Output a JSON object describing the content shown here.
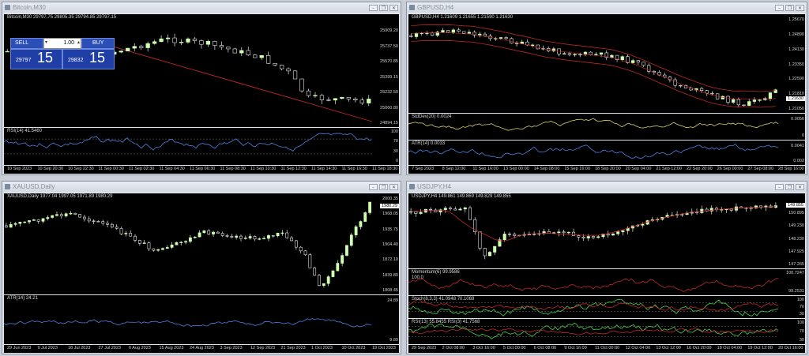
{
  "windows": [
    {
      "id": "btc",
      "title": "Bitcoin,M30",
      "price_label": "Bitcoin,M30  29797.75 29805.35 29794.85 29797.15",
      "price_ticks": [
        "25909.20",
        "25737.50",
        "25570.85",
        "25399.15",
        "25232.50",
        "25060.80",
        "24894.15"
      ],
      "indicator_label": "RSI(14) 41.5460",
      "indicator_ticks": [
        "100",
        "70",
        "30",
        "0"
      ],
      "time_ticks": [
        "10 Sep 2023",
        "10 Sep 20:30",
        "10 Sep 22:30",
        "11 Sep 00:30",
        "11 Sep 02:30",
        "11 Sep 04:30",
        "11 Sep 06:30",
        "11 Sep 08:30",
        "11 Sep 10:30",
        "11 Sep 12:30",
        "11 Sep 14:30",
        "11 Sep 16:30",
        "11 Sep 18:30"
      ]
    },
    {
      "id": "gbp",
      "title": "GBPUSD,H4",
      "price_label": "GBPUSD,H4  1.21609 1.21655 1.21590 1.21630",
      "price_ticks": [
        "1.25670",
        "1.24890",
        "1.24130",
        "1.23350",
        "1.22590",
        "1.21810",
        "1.21050"
      ],
      "current_price": "1.21630",
      "indicators": [
        {
          "label": "StdDev(20) 0.0024",
          "ticks": [
            "0.0056",
            "0"
          ]
        },
        {
          "label": "ATR(14) 0.0033",
          "ticks": [
            "0.0041",
            "0.002"
          ]
        }
      ],
      "time_ticks": [
        "7 Sep 2023",
        "8 Sep 12:00",
        "11 Sep 16:00",
        "13 Sep 00:00",
        "14 Sep 08:00",
        "15 Sep 16:00",
        "18 Sep 20:00",
        "20 Sep 04:00",
        "21 Sep 12:00",
        "22 Sep 20:00",
        "26 Sep 00:00",
        "27 Sep 08:00",
        "28 Sep 16:00"
      ]
    },
    {
      "id": "xau",
      "title": "XAUUSD,Daily",
      "price_label": "XAUUSD,Daily  1977.04 1997.05 1971.89 1980.29",
      "price_ticks": [
        "2000.35",
        "1968.05",
        "1935.75",
        "1904.40",
        "1872.10",
        "1839.80",
        "1808.45"
      ],
      "current_price": "1980.29",
      "indicator_label": "ATR(14) 24.21",
      "indicator_ticks": [
        "24.89",
        "9.89"
      ],
      "time_ticks": [
        "29 Jun 2023",
        "9 Jul 2023",
        "18 Jul 2023",
        "27 Jul 2023",
        "6 Aug 2023",
        "15 Aug 2023",
        "24 Aug 2023",
        "3 Sep 2023",
        "12 Sep 2023",
        "21 Sep 2023",
        "1 Oct 2023",
        "10 Oct 2023",
        "19 Oct 2023"
      ]
    },
    {
      "id": "jpy",
      "title": "USDJPY,H4",
      "price_label": "USDJPY,H4  149.861 149.869 149.829 149.855",
      "price_ticks": [
        "150.895",
        "149.230",
        "148.230",
        "147.925",
        "147.265"
      ],
      "current_price": "149.855",
      "indicators": [
        {
          "label": "Momentum(6) 99.9586",
          "extra": "100.0",
          "ticks": [
            "100.7247",
            "99.2531"
          ]
        },
        {
          "label": "Stoch(8,3,3) 41.0948 70.1069",
          "ticks": [
            "100",
            "70",
            "30"
          ]
        },
        {
          "label": "RSI(13) 55.8455  RSI(3) 41.7568",
          "ticks": [
            "100",
            "70",
            "30"
          ]
        }
      ],
      "time_ticks": [
        "29 Sep 2023",
        "2 Oct 08:00",
        "3 Oct 16:00",
        "5 Oct 00:00",
        "6 Oct 08:00",
        "9 Oct 16:00",
        "11 Oct 00:00",
        "12 Oct 04:00",
        "13 Oct 12:00",
        "16 Oct 20:00",
        "18 Oct 04:00",
        "19 Oct 12:00",
        "20 Oct 16:00"
      ]
    }
  ],
  "trade_panel": {
    "sell_label": "SELL",
    "buy_label": "BUY",
    "lot": "1.00",
    "sell_price_small": "29797",
    "sell_price_big": "15",
    "buy_price_small": "29832",
    "buy_price_big": "15"
  },
  "window_buttons": {
    "minimize": "–",
    "restore": "❐",
    "close": "✕"
  },
  "colors": {
    "bull": "#cfffb0",
    "bear": "#e8e8e8",
    "ma": "#c0282a",
    "band": "#c0282a",
    "line_blue": "#4f7fe0",
    "line_yellow": "#d8d070",
    "line_green": "#49d049",
    "level": "#7a7a7a"
  }
}
